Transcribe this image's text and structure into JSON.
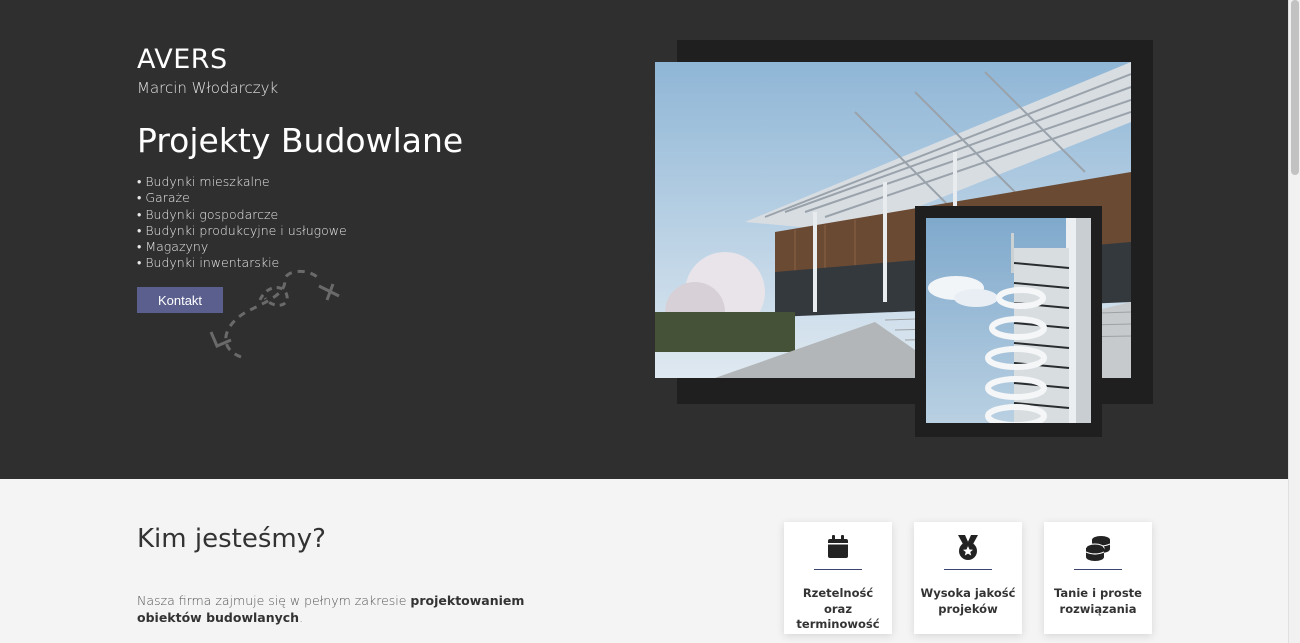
{
  "hero": {
    "brand": "AVERS",
    "owner": "Marcin Włodarczyk",
    "title": "Projekty Budowlane",
    "services": [
      "Budynki mieszkalne",
      "Garaże",
      "Budynki gospodarcze",
      "Budynki produkcyjne i usługowe",
      "Magazyny",
      "Budynki inwentarskie"
    ],
    "cta_label": "Kontakt"
  },
  "about": {
    "title": "Kim jesteśmy?",
    "text_prefix": "Nasza firma zajmuje się w pełnym zakresie ",
    "text_bold": "projektowaniem obiektów budowlanych",
    "text_suffix": "."
  },
  "features": [
    {
      "icon": "calendar-icon",
      "label": "Rzetelność oraz terminowość"
    },
    {
      "icon": "medal-icon",
      "label": "Wysoka jakość projeków"
    },
    {
      "icon": "coins-icon",
      "label": "Tanie i proste rozwiązania"
    }
  ],
  "colors": {
    "hero_bg": "#2f2f2f",
    "accent": "#5a5f8e",
    "frame": "#1f1f1f",
    "section_bg": "#f4f4f4"
  }
}
